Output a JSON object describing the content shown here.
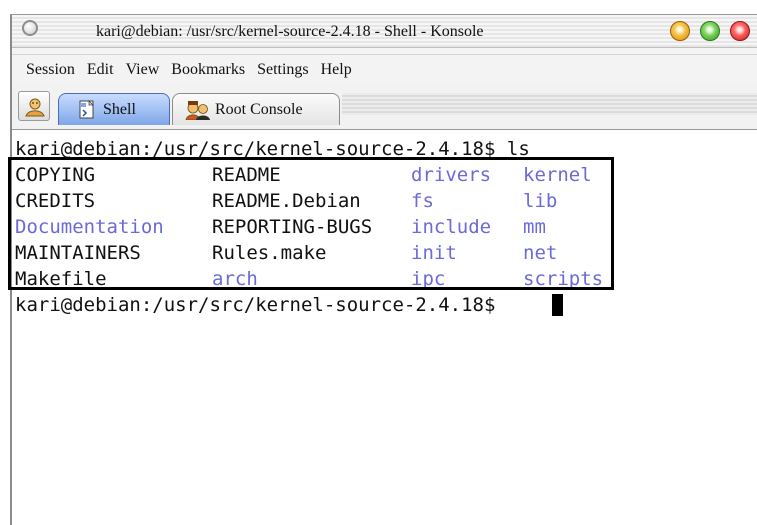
{
  "window": {
    "title": "kari@debian: /usr/src/kernel-source-2.4.18 - Shell - Konsole"
  },
  "menubar": {
    "items": [
      "Session",
      "Edit",
      "View",
      "Bookmarks",
      "Settings",
      "Help"
    ]
  },
  "tabs": [
    {
      "label": "Shell",
      "icon": "shell-icon",
      "active": true
    },
    {
      "label": "Root Console",
      "icon": "root-console-icon",
      "active": false
    }
  ],
  "terminal": {
    "prompt_line_1": "kari@debian:/usr/src/kernel-source-2.4.18$ ls",
    "ls_output": {
      "col1": [
        "COPYING",
        "CREDITS",
        "Documentation",
        "MAINTAINERS",
        "Makefile"
      ],
      "col2": [
        "README",
        "README.Debian",
        "REPORTING-BUGS",
        "Rules.make",
        "arch"
      ],
      "col3": [
        "drivers",
        "fs",
        "include",
        "init",
        "ipc"
      ],
      "col4": [
        "kernel",
        "lib",
        "mm",
        "net",
        "scripts"
      ]
    },
    "directory_entries": [
      "Documentation",
      "arch",
      "drivers",
      "fs",
      "include",
      "init",
      "ipc",
      "kernel",
      "lib",
      "mm",
      "net",
      "scripts"
    ],
    "prompt_line_2": "kari@debian:/usr/src/kernel-source-2.4.18$ "
  },
  "colors": {
    "directory": "#6a6ad8",
    "file": "#111111",
    "highlight_box": "#000000"
  }
}
